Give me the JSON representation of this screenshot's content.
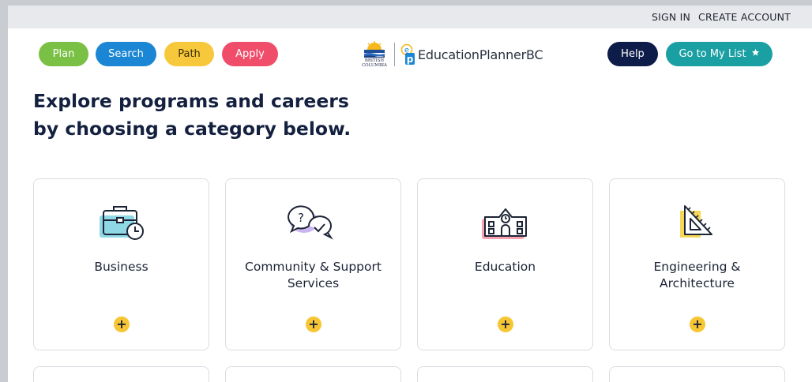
{
  "topbar": {
    "sign_in": "SIGN IN",
    "create_account": "CREATE ACCOUNT"
  },
  "nav": {
    "plan": "Plan",
    "search": "Search",
    "path": "Path",
    "apply": "Apply",
    "help": "Help",
    "my_list": "Go to My List",
    "my_list_icon": "star-icon"
  },
  "logo": {
    "bc_line1": "BRITISH",
    "bc_line2": "COLUMBIA",
    "wordmark": "EducationPlannerBC"
  },
  "heading": {
    "line1": "Explore programs and careers",
    "line2": "by choosing a category below."
  },
  "categories": [
    {
      "label": "Business",
      "icon": "briefcase-clock-icon"
    },
    {
      "label": "Community & Support Services",
      "icon": "speech-bubbles-icon"
    },
    {
      "label": "Education",
      "icon": "school-building-icon"
    },
    {
      "label": "Engineering & Architecture",
      "icon": "set-square-icon"
    }
  ],
  "expand_symbol": "+",
  "colors": {
    "plan": "#79c044",
    "search": "#1b86d3",
    "path": "#f7c83b",
    "apply": "#f04d6a",
    "help": "#0d1c48",
    "my_list": "#1aa0a3",
    "plus": "#f6c634"
  }
}
